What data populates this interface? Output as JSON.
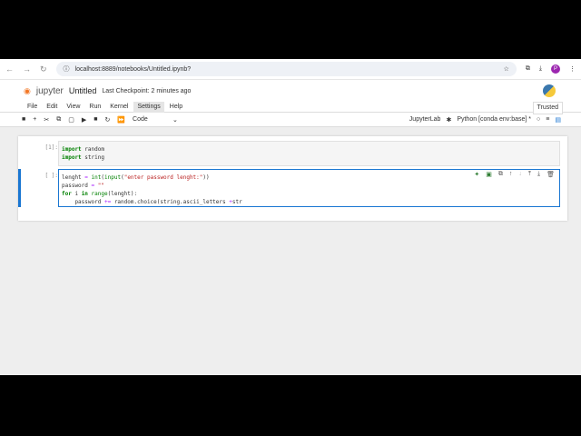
{
  "browser": {
    "url": "localhost:8889/notebooks/Untitled.ipynb?",
    "avatar": "P"
  },
  "header": {
    "logo": "jupyter",
    "title": "Untitled",
    "checkpoint": "Last Checkpoint: 2 minutes ago"
  },
  "menu": [
    "File",
    "Edit",
    "View",
    "Run",
    "Kernel",
    "Settings",
    "Help"
  ],
  "trusted": "Trusted",
  "toolbar": {
    "cell_type": "Code",
    "jupyterlab": "JupyterLab",
    "kernel": "Python [conda env:base] *"
  },
  "cells": [
    {
      "prompt": "[1]:",
      "lines": [
        "import random",
        "import string"
      ]
    },
    {
      "prompt": "[ ]:",
      "lines": [
        "lenght = int(input(\"enter password lenght:\"))",
        "password = \"\"",
        "for i in range(lenght):",
        "    password += random.choice(string.ascii_letters +str"
      ]
    }
  ]
}
